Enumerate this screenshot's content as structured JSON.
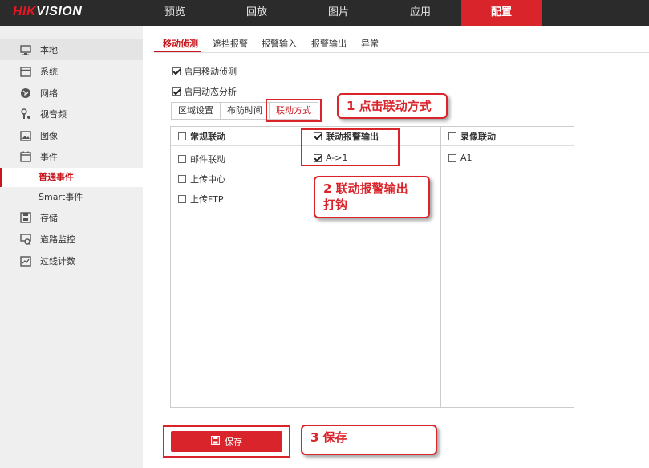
{
  "brand": {
    "part1": "HIK",
    "part2": "VISION"
  },
  "nav": [
    "预览",
    "回放",
    "图片",
    "应用",
    "配置"
  ],
  "sidebar": {
    "items": [
      {
        "label": "本地",
        "icon": "monitor-icon"
      },
      {
        "label": "系统",
        "icon": "system-icon"
      },
      {
        "label": "网络",
        "icon": "globe-icon"
      },
      {
        "label": "视音频",
        "icon": "audio-video-icon"
      },
      {
        "label": "图像",
        "icon": "image-icon"
      },
      {
        "label": "事件",
        "icon": "calendar-icon"
      }
    ],
    "sub_items": [
      "普通事件",
      "Smart事件"
    ],
    "items_after": [
      {
        "label": "存储",
        "icon": "storage-icon"
      },
      {
        "label": "道路监控",
        "icon": "road-monitor-icon"
      },
      {
        "label": "过线计数",
        "icon": "line-count-icon"
      }
    ]
  },
  "subtabs": [
    "移动侦测",
    "遮挡报警",
    "报警输入",
    "报警输出",
    "异常"
  ],
  "options": {
    "enable_motion": "启用移动侦测",
    "enable_dynamic": "启用动态分析"
  },
  "steps": [
    "区域设置",
    "布防时间",
    "联动方式"
  ],
  "table": {
    "col1": {
      "header": "常规联动",
      "items": [
        "邮件联动",
        "上传中心",
        "上传FTP"
      ]
    },
    "col2": {
      "header": "联动报警输出",
      "items": [
        "A->1"
      ]
    },
    "col3": {
      "header": "录像联动",
      "items": [
        "A1"
      ]
    }
  },
  "save_label": "保存",
  "annotations": {
    "step1": "1 点击联动方式",
    "step2_line1": "2 联动报警输出",
    "step2_line2": "打钩",
    "step3": "3 保存"
  },
  "colors": {
    "accent": "#d9242b",
    "topbar": "#2b2b2b",
    "sidebar": "#efefef"
  }
}
